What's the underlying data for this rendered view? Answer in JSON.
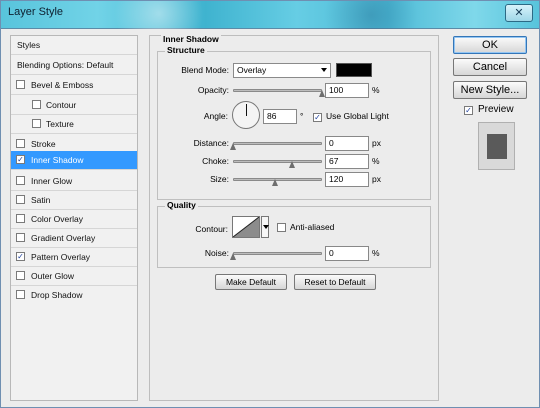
{
  "window": {
    "title": "Layer Style",
    "close": "✕"
  },
  "sidebar": {
    "header": "Styles",
    "blending": "Blending Options: Default",
    "items": [
      {
        "label": "Bevel & Emboss",
        "checked": false,
        "indent": 0
      },
      {
        "label": "Contour",
        "checked": false,
        "indent": 1
      },
      {
        "label": "Texture",
        "checked": false,
        "indent": 1
      },
      {
        "label": "Stroke",
        "checked": false,
        "indent": 0
      },
      {
        "label": "Inner Shadow",
        "checked": true,
        "indent": 0,
        "selected": true
      },
      {
        "label": "Inner Glow",
        "checked": false,
        "indent": 0
      },
      {
        "label": "Satin",
        "checked": false,
        "indent": 0
      },
      {
        "label": "Color Overlay",
        "checked": false,
        "indent": 0
      },
      {
        "label": "Gradient Overlay",
        "checked": false,
        "indent": 0
      },
      {
        "label": "Pattern Overlay",
        "checked": true,
        "indent": 0
      },
      {
        "label": "Outer Glow",
        "checked": false,
        "indent": 0
      },
      {
        "label": "Drop Shadow",
        "checked": false,
        "indent": 0
      }
    ]
  },
  "panel": {
    "title": "Inner Shadow",
    "structure": {
      "title": "Structure",
      "blend_mode_label": "Blend Mode:",
      "blend_mode_value": "Overlay",
      "opacity_label": "Opacity:",
      "opacity_value": "100",
      "opacity_unit": "%",
      "angle_label": "Angle:",
      "angle_value": "86",
      "angle_unit": "°",
      "use_global_light_label": "Use Global Light",
      "use_global_light_checked": true,
      "distance_label": "Distance:",
      "distance_value": "0",
      "distance_unit": "px",
      "choke_label": "Choke:",
      "choke_value": "67",
      "choke_unit": "%",
      "size_label": "Size:",
      "size_value": "120",
      "size_unit": "px",
      "sliders": {
        "opacity": 1.0,
        "distance": 0.0,
        "choke": 0.67,
        "size": 0.48
      }
    },
    "quality": {
      "title": "Quality",
      "contour_label": "Contour:",
      "anti_aliased_label": "Anti-aliased",
      "anti_aliased_checked": false,
      "noise_label": "Noise:",
      "noise_value": "0",
      "noise_unit": "%",
      "noise_slider": 0.0
    },
    "buttons": {
      "make_default": "Make Default",
      "reset_to_default": "Reset to Default"
    }
  },
  "actions": {
    "ok": "OK",
    "cancel": "Cancel",
    "new_style": "New Style...",
    "preview_label": "Preview",
    "preview_checked": true
  },
  "colors": {
    "selection": "#3399ff",
    "shadow_color": "#000000",
    "preview_square": "#5a5a5a"
  }
}
